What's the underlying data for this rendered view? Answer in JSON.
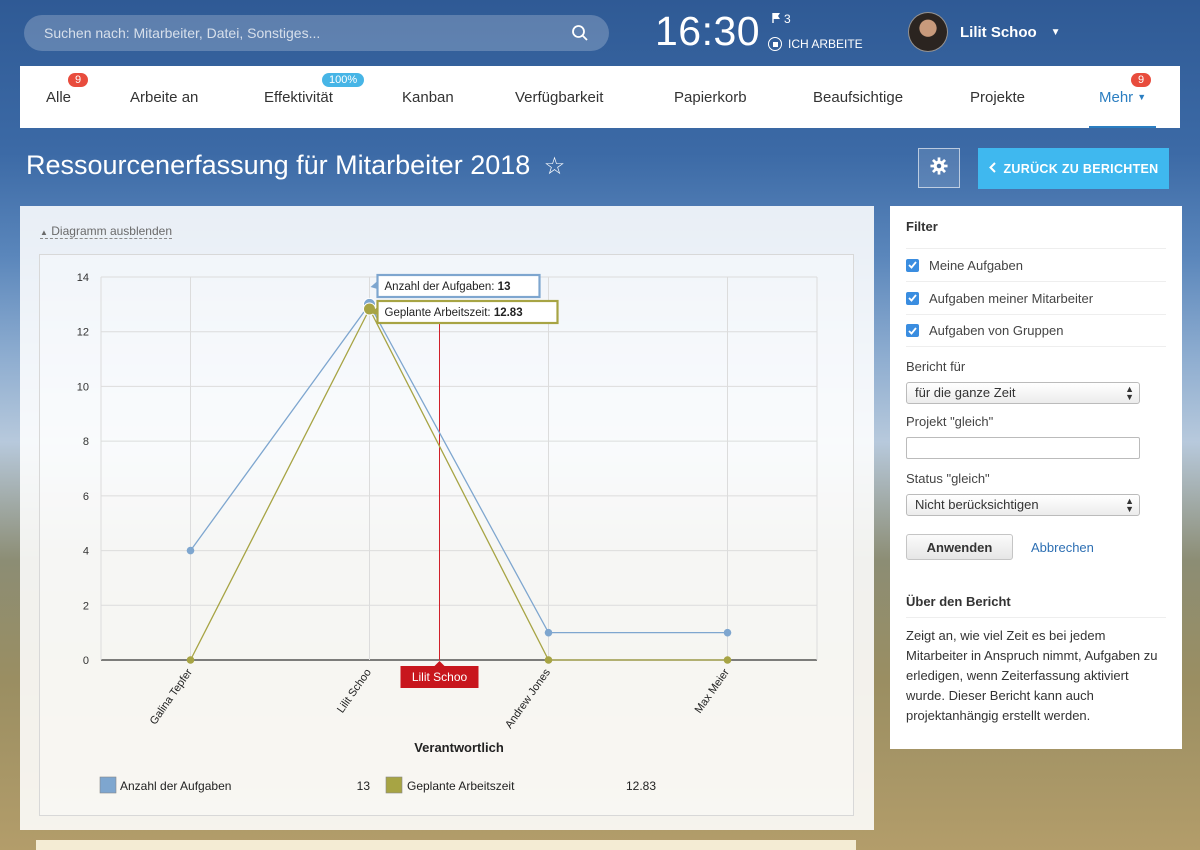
{
  "search": {
    "placeholder": "Suchen nach: Mitarbeiter, Datei, Sonstiges..."
  },
  "status": {
    "time": "16:30",
    "flag_count": "3",
    "working_label": "ICH ARBEITE"
  },
  "user": {
    "name": "Lilit Schoo"
  },
  "nav": {
    "tabs": [
      {
        "label": "Alle",
        "badge": "9"
      },
      {
        "label": "Arbeite an"
      },
      {
        "label": "Effektivität",
        "badge": "100%"
      },
      {
        "label": "Kanban"
      },
      {
        "label": "Verfügbarkeit"
      },
      {
        "label": "Papierkorb"
      },
      {
        "label": "Beaufsichtige"
      },
      {
        "label": "Projekte"
      },
      {
        "label": "Mehr",
        "badge": "9"
      }
    ]
  },
  "page": {
    "title": "Ressourcenerfassung für Mitarbeiter 2018",
    "star": "☆",
    "back_label": "ZURÜCK ZU BERICHTEN"
  },
  "main": {
    "hide_chart_label": "Diagramm ausblenden"
  },
  "chart_data": {
    "type": "line",
    "categories": [
      "Galina Tepfer",
      "Lilit Schoo",
      "Andrew Jones",
      "Max Meier"
    ],
    "series": [
      {
        "name": "Anzahl der Aufgaben",
        "values": [
          4,
          13,
          1,
          1
        ],
        "color": "#7ea6cf",
        "total": "13"
      },
      {
        "name": "Geplante Arbeitszeit",
        "values": [
          0,
          12.83,
          0,
          0
        ],
        "color": "#a7a444",
        "total": "12.83"
      }
    ],
    "xlabel": "Verantwortlich",
    "ylim": [
      0,
      14
    ],
    "yticks": [
      0,
      2,
      4,
      6,
      8,
      10,
      12,
      14
    ],
    "grid": true,
    "legend": "bottom",
    "tooltip": {
      "category": "Lilit Schoo",
      "lines": [
        {
          "label": "Anzahl der Aufgaben: ",
          "value": "13"
        },
        {
          "label": "Geplante Arbeitszeit: ",
          "value": "12.83"
        }
      ],
      "crosshair_color": "#d0202a"
    }
  },
  "filter": {
    "title": "Filter",
    "checkboxes": [
      {
        "label": "Meine Aufgaben",
        "checked": true
      },
      {
        "label": "Aufgaben meiner Mitarbeiter",
        "checked": true
      },
      {
        "label": "Aufgaben von Gruppen",
        "checked": true
      }
    ],
    "report_label": "Bericht für",
    "report_value": "für die ganze Zeit",
    "project_label": "Projekt \"gleich\"",
    "project_value": "",
    "status_label": "Status \"gleich\"",
    "status_value": "Nicht berücksichtigen",
    "apply_label": "Anwenden",
    "cancel_label": "Abbrechen"
  },
  "about": {
    "title": "Über den Bericht",
    "text": "Zeigt an, wie viel Zeit es bei jedem Mitarbeiter in Anspruch nimmt, Aufgaben zu erledigen, wenn Zeiterfassung aktiviert wurde. Dieser Bericht kann auch projektanhängig erstellt werden."
  }
}
